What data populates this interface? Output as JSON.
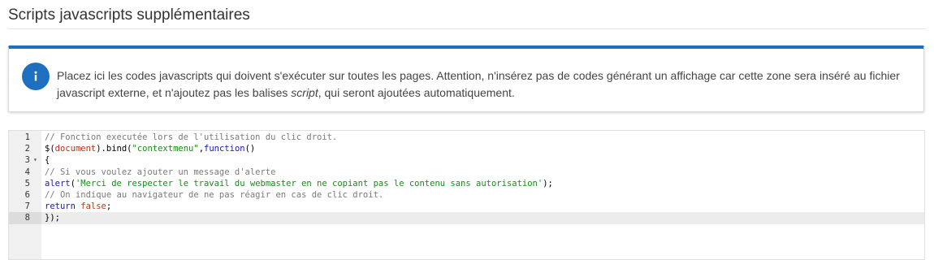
{
  "section": {
    "title": "Scripts javascripts supplémentaires"
  },
  "alert": {
    "icon": "info-icon",
    "accent_color": "#1e6fbf",
    "text_before": "Placez ici les codes javascripts qui doivent s'exécuter sur toutes les pages. Attention, n'insérez pas de codes générant un affichage car cette zone sera inséré au fichier javascript externe, et n'ajoutez pas les balises ",
    "text_em": "script",
    "text_after": ", qui seront ajoutées automatiquement."
  },
  "editor": {
    "active_line": 8,
    "lines": [
      {
        "n": "1",
        "tokens": [
          {
            "t": "// Fonction executée lors de l'utilisation du clic droit.",
            "c": "cm"
          }
        ]
      },
      {
        "n": "2",
        "tokens": [
          {
            "t": "$(",
            "c": ""
          },
          {
            "t": "document",
            "c": "vr"
          },
          {
            "t": ").bind(",
            "c": ""
          },
          {
            "t": "\"contextmenu\"",
            "c": "st"
          },
          {
            "t": ",",
            "c": ""
          },
          {
            "t": "function",
            "c": "kw"
          },
          {
            "t": "()",
            "c": ""
          }
        ]
      },
      {
        "n": "3",
        "fold": "▾",
        "tokens": [
          {
            "t": "{",
            "c": ""
          }
        ]
      },
      {
        "n": "4",
        "tokens": [
          {
            "t": "// Si vous voulez ajouter un message d'alerte",
            "c": "cm"
          }
        ]
      },
      {
        "n": "5",
        "tokens": [
          {
            "t": "alert",
            "c": "fn"
          },
          {
            "t": "(",
            "c": ""
          },
          {
            "t": "'Merci de respecter le travail du webmaster en ne copiant pas le contenu sans autorisation'",
            "c": "st"
          },
          {
            "t": ");",
            "c": ""
          }
        ]
      },
      {
        "n": "6",
        "tokens": [
          {
            "t": "// On indique au navigateur de ne pas réagir en cas de clic droit.",
            "c": "cm"
          }
        ]
      },
      {
        "n": "7",
        "tokens": [
          {
            "t": "return ",
            "c": "kw"
          },
          {
            "t": "false",
            "c": "vr"
          },
          {
            "t": ";",
            "c": ""
          }
        ]
      },
      {
        "n": "8",
        "tokens": [
          {
            "t": "});",
            "c": ""
          }
        ]
      }
    ]
  }
}
